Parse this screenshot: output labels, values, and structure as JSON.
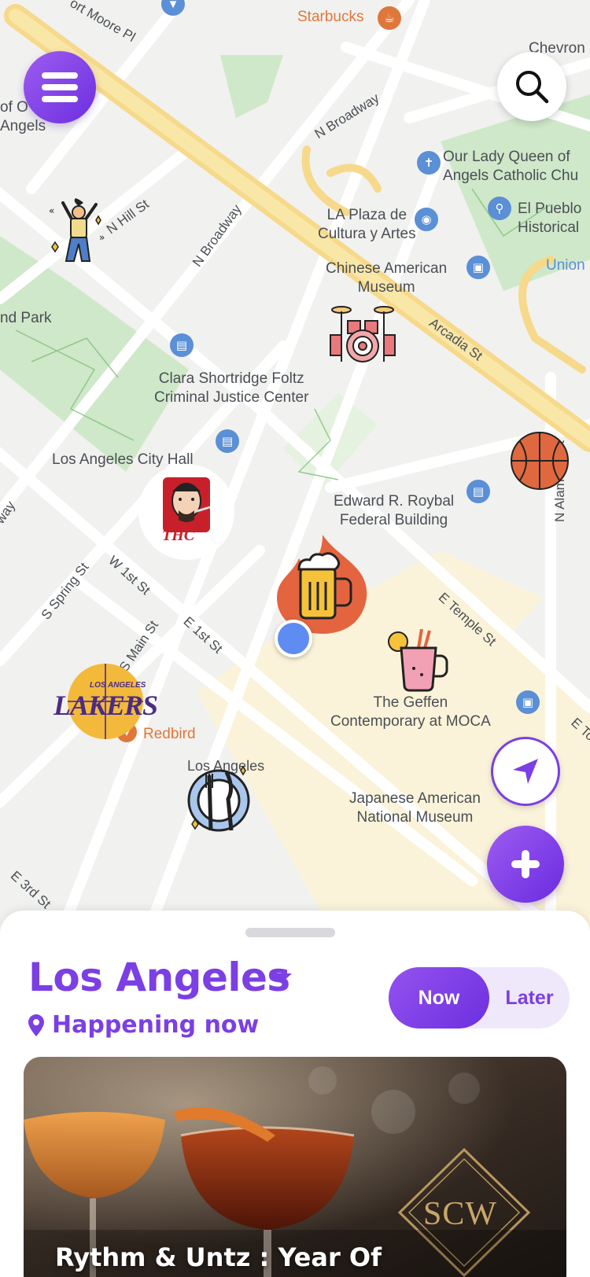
{
  "map": {
    "places": {
      "starbucks": "Starbucks",
      "chevron": "Chevron",
      "our_lady": "Our Lady Queen of\nAngels Catholic Chu",
      "plaza_cultura": "LA Plaza de\nCultura y Artes",
      "el_pueblo": "El Pueblo\nHistorical",
      "chinese_museum": "Chinese American\nMuseum",
      "union": "Union",
      "park": "nd Park",
      "foltz": "Clara Shortridge Foltz\nCriminal Justice Center",
      "city_hall": "Los Angeles City Hall",
      "roybal": "Edward R. Roybal\nFederal Building",
      "geffen": "The Geffen\nContemporary at MOCA",
      "redbird": "Redbird",
      "la_label": "Los Angeles",
      "japanese_museum": "Japanese American\nNational Museum",
      "of_angels": "of O\nAngels"
    },
    "streets": {
      "fort_moore": "ort Moore Pl",
      "n_broadway_top": "N Broadway",
      "n_hill": "N Hill St",
      "n_broadway_mid": "N Broadway",
      "arcadia": "Arcadia St",
      "n_alameda": "N Alameda St",
      "s_spring": "S Spring St",
      "w_1st": "W 1st St",
      "s_main": "S Main St",
      "e_1st": "E 1st St",
      "e_temple": "E Temple St",
      "e_3rd": "E 3rd St",
      "way": "way",
      "e_to": "E To"
    },
    "pins": {
      "thc_text": "THC",
      "lakers_top": "LOS ANGELES",
      "lakers_main": "LAKERS"
    }
  },
  "buttons": {
    "menu_icon": "hamburger-menu-icon",
    "search_icon": "search-icon",
    "locate_icon": "navigation-arrow-icon",
    "add_icon": "plus-icon"
  },
  "sheet": {
    "city": "Los Angeles",
    "status": "Happening now",
    "toggle": {
      "now": "Now",
      "later": "Later",
      "selected": "Now"
    }
  },
  "event": {
    "title": "Rythm & Untz : Year Of",
    "logo_text": "SCW"
  },
  "colors": {
    "accent": "#7b3fe4",
    "map_road_major": "#f7e39a",
    "map_park": "#c8e6c3",
    "user_location": "#5f8cf0"
  }
}
